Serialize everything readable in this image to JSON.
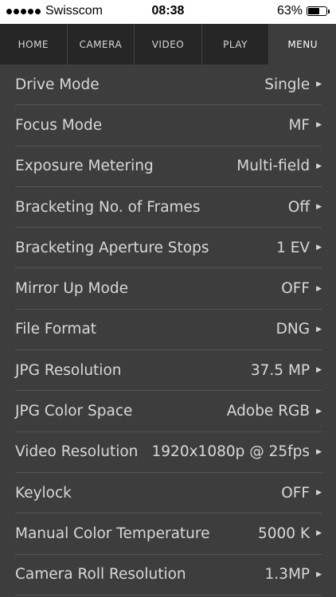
{
  "status_bar": {
    "carrier": "Swisscom",
    "time": "08:38",
    "battery_percent_label": "63%",
    "battery_level": 0.63
  },
  "tabs": [
    {
      "label": "HOME",
      "active": false
    },
    {
      "label": "CAMERA",
      "active": false
    },
    {
      "label": "VIDEO",
      "active": false
    },
    {
      "label": "PLAY",
      "active": false
    },
    {
      "label": "MENU",
      "active": true
    }
  ],
  "menu": {
    "items": [
      {
        "label": "Drive Mode",
        "value": "Single"
      },
      {
        "label": "Focus Mode",
        "value": "MF"
      },
      {
        "label": "Exposure Metering",
        "value": "Multi-field"
      },
      {
        "label": "Bracketing No. of Frames",
        "value": "Off"
      },
      {
        "label": "Bracketing Aperture Stops",
        "value": "1 EV"
      },
      {
        "label": "Mirror Up Mode",
        "value": "OFF"
      },
      {
        "label": "File Format",
        "value": "DNG"
      },
      {
        "label": "JPG Resolution",
        "value": "37.5 MP"
      },
      {
        "label": "JPG Color Space",
        "value": "Adobe RGB"
      },
      {
        "label": "Video Resolution",
        "value": "1920x1080p @ 25fps"
      },
      {
        "label": "Keylock",
        "value": "OFF"
      },
      {
        "label": "Manual Color Temperature",
        "value": "5000 K"
      },
      {
        "label": "Camera Roll Resolution",
        "value": "1.3MP"
      }
    ],
    "chevron_icon": "chevron-right-icon"
  },
  "colors": {
    "background": "#3d3d3d",
    "tab_bar": "#262626",
    "text": "#d8d8d8"
  }
}
